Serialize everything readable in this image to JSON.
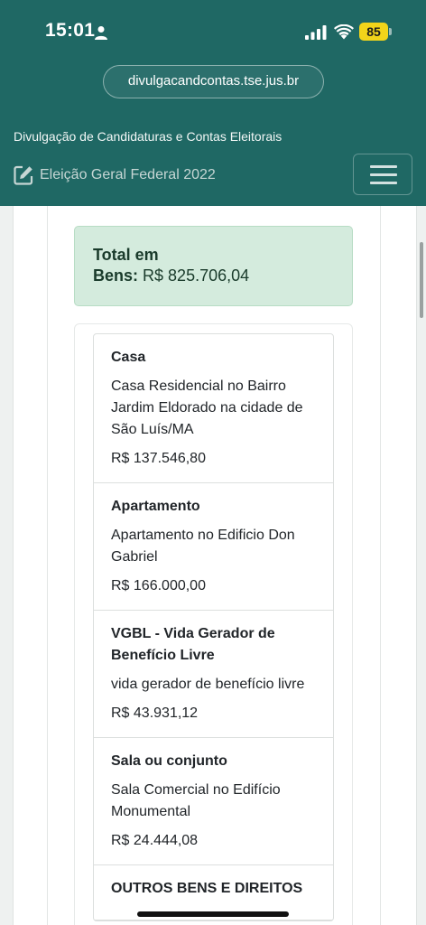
{
  "status": {
    "time": "15:01",
    "battery": "85",
    "icons": [
      "person-icon",
      "signal-icon",
      "wifi-icon"
    ],
    "battery_color": "#f2d41a"
  },
  "browser": {
    "url": "divulgacandcontas.tse.jus.br"
  },
  "header": {
    "title": "Divulgação de Candidaturas e Contas Eleitorais",
    "election": "Eleição Geral Federal 2022",
    "brand_color": "#1f6864",
    "election_icon": "edit-icon",
    "menu_icon": "hamburger-menu-icon"
  },
  "summary": {
    "label_line1": "Total em",
    "label_line2": "Bens:",
    "value": "R$ 825.706,04",
    "box_color": "#d4ebdd"
  },
  "assets": [
    {
      "title": "Casa",
      "description": "Casa Residencial no Bairro Jardim Eldorado na cidade de São Luís/MA",
      "value": "R$ 137.546,80"
    },
    {
      "title": "Apartamento",
      "description": "Apartamento no Edificio Don Gabriel",
      "value": "R$ 166.000,00"
    },
    {
      "title": "VGBL - Vida Gerador de Benefício Livre",
      "description": "vida gerador de benefício livre",
      "value": "R$ 43.931,12"
    },
    {
      "title": "Sala ou conjunto",
      "description": "Sala Comercial no Edifício Monumental",
      "value": "R$ 24.444,08"
    },
    {
      "title": "OUTROS BENS E DIREITOS",
      "description": "",
      "value": ""
    }
  ]
}
